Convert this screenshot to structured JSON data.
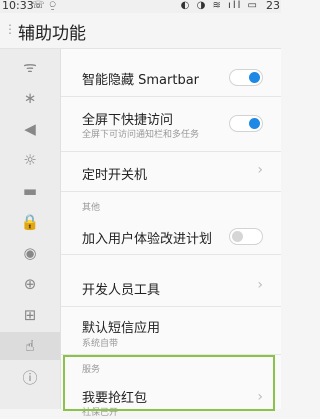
{
  "status_bar": {
    "time": "10:33",
    "left_icons": "☏ ⍜",
    "right_icons": "◐ ◑ ≋ ıll ▭",
    "battery_percent": "23"
  },
  "header": {
    "menu_glyph": "⋮",
    "title": "辅助功能"
  },
  "sidebar": {
    "items": [
      {
        "icon": "wifi-icon",
        "glyph": "ᯤ"
      },
      {
        "icon": "bluetooth-icon",
        "glyph": "∗"
      },
      {
        "icon": "volume-icon",
        "glyph": "◀"
      },
      {
        "icon": "brightness-icon",
        "glyph": "☼"
      },
      {
        "icon": "battery-icon",
        "glyph": "▬"
      },
      {
        "icon": "lock-icon",
        "glyph": "🔒"
      },
      {
        "icon": "location-icon",
        "glyph": "◉"
      },
      {
        "icon": "globe-icon",
        "glyph": "⊕"
      },
      {
        "icon": "apps-grid-icon",
        "glyph": "⊞"
      },
      {
        "icon": "hand-pointer-icon",
        "glyph": "☝"
      },
      {
        "icon": "info-icon",
        "glyph": "ⓘ"
      }
    ]
  },
  "settings": {
    "smartbar_label": "智能隐藏 Smartbar",
    "smartbar_on": true,
    "fullscreen_label": "全屏下快捷访问",
    "fullscreen_sub": "全屏下可访问通知栏和多任务",
    "fullscreen_on": true,
    "timer_power_label": "定时开关机",
    "section_other": "其他",
    "ux_program_label": "加入用户体验改进计划",
    "ux_program_on": false,
    "dev_tools_label": "开发人员工具",
    "default_sms_label": "默认短信应用",
    "default_sms_sub": "系统自带",
    "section_services": "服务",
    "red_packet_label": "我要抢红包",
    "red_packet_sub": "社保已开",
    "chevron": "›"
  },
  "colors": {
    "accent": "#1e88e5",
    "highlight": "#8bc34a"
  }
}
